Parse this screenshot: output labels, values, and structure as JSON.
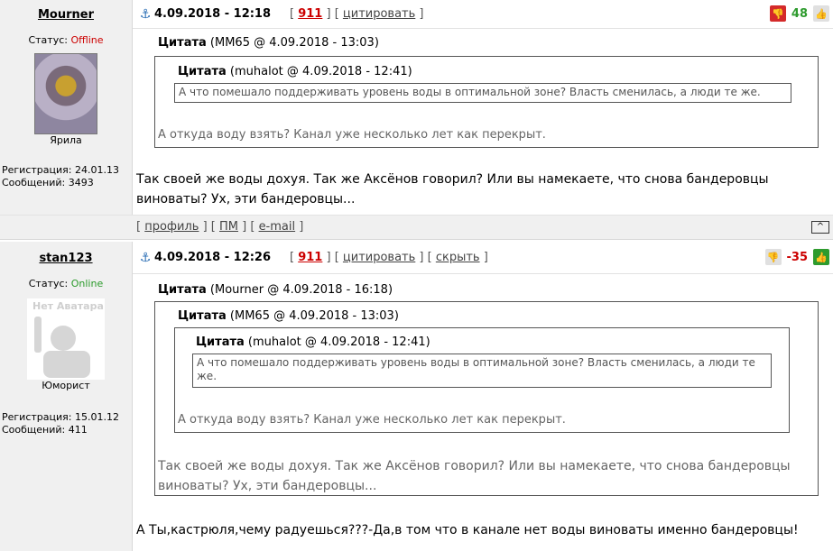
{
  "posts": [
    {
      "username": "Mourner",
      "status_label": "Статус: ",
      "status_value": "Offline",
      "rank": "Ярила",
      "reg_label": "Регистрация: 24.01.13",
      "msgs_label": "Сообщений: 3493",
      "date": "4.09.2018 - 12:18",
      "count": "911",
      "actions": [
        "цитировать"
      ],
      "rating": "48",
      "quote1_header_name": "Цитата",
      "quote1_header_meta": " (MM65 @ 4.09.2018 - 13:03)",
      "quote2_header_name": "Цитата",
      "quote2_header_meta": " (muhalot @ 4.09.2018 - 12:41)",
      "quote2_text": "А что помешало поддерживать уровень воды в оптимальной зоне? Власть сменилась, а люди те же.",
      "quote1_text": "А откуда воду взять? Канал уже несколько лет как перекрыт.",
      "body": "Так своей же воды дохуя. Так же Аксёнов говорил? Или вы намекаете, что снова бандеровцы виноваты? Ух, эти бандеровцы...",
      "footer_links": [
        "профиль",
        "ПМ",
        "e-mail"
      ],
      "up_label": "^"
    },
    {
      "username": "stan123",
      "status_label": "Статус: ",
      "status_value": "Online",
      "avatar_text": "Нет Аватара",
      "rank": "Юморист",
      "reg_label": "Регистрация: 15.01.12",
      "msgs_label": "Сообщений: 411",
      "date": "4.09.2018 - 12:26",
      "count": "911",
      "actions": [
        "цитировать",
        "скрыть"
      ],
      "rating": "-35",
      "quote1_header_name": "Цитата",
      "quote1_header_meta": " (Mourner @ 4.09.2018 - 16:18)",
      "quote2_header_name": "Цитата",
      "quote2_header_meta": " (MM65 @ 4.09.2018 - 13:03)",
      "quote3_header_name": "Цитата",
      "quote3_header_meta": " (muhalot @ 4.09.2018 - 12:41)",
      "quote3_text": "А что помешало поддерживать уровень воды в оптимальной зоне? Власть сменилась, а люди те же.",
      "quote2_text": "А откуда воду взять? Канал уже несколько лет как перекрыт.",
      "quote1_text": "Так своей же воды дохуя. Так же Аксёнов говорил? Или вы намекаете, что снова бандеровцы виноваты? Ух, эти бандеровцы...",
      "body": "А Ты,кастрюля,чему радуешься???-Да,в том что в канале нет воды виноваты именно бандеровцы!"
    }
  ],
  "colors": {
    "offline": "#cc0000",
    "online": "#2a9a2a",
    "down": "#d42a2a",
    "up": "#2e9b2e"
  },
  "icons": {
    "anchor": "anchor-icon",
    "thumb_down": "thumb-down-icon",
    "thumb_up": "thumb-up-icon"
  }
}
